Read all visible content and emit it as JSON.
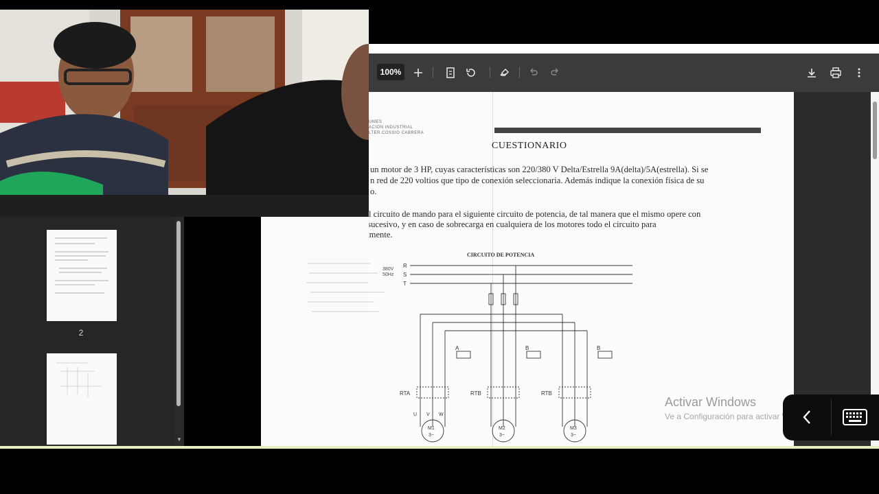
{
  "viewer": {
    "zoom_label": "100%",
    "toolbar_icons": [
      "zoom-in-icon",
      "fit-page-icon",
      "rotate-icon",
      "annotate-icon",
      "undo-icon",
      "redo-icon",
      "download-icon",
      "print-icon",
      "more-options-icon"
    ]
  },
  "document": {
    "header_lines": [
      "UMES",
      "ACION INDUSTRIAL",
      "LTER COSSIO CABRERA"
    ],
    "title": "CUESTIONARIO",
    "q1_line1": "un motor de 3 HP, cuyas características son  220/380 V Delta/Estrella 9A(delta)/5A(estrella). Si se",
    "q1_line2": "n red de 220 voltios que tipo de conexión seleccionaria. Además indique la conexión física de su",
    "q1_line3": "o.",
    "q2_line1": "l circuito de mando para el siguiente circuito de potencia, de tal manera que el mismo opere con",
    "q2_line2": "arranque sucesivo, y en caso de sobrecarga en cualquiera de los motores todo el circuito para",
    "q2_line3": "inmediatamente.",
    "diagram": {
      "title": "CIRCUITO DE POTENCIA",
      "supply": [
        "380V",
        "50Hz"
      ],
      "phases": [
        "R",
        "S",
        "T"
      ],
      "contactors": [
        "A",
        "B",
        "B"
      ],
      "relays": [
        "RTA",
        "RTB",
        "RTB"
      ],
      "motors": [
        "M1",
        "M2",
        "M3"
      ],
      "motor_sub": "3~",
      "terminals": [
        "U",
        "V",
        "W"
      ]
    }
  },
  "thumbnails": {
    "page_label": "2"
  },
  "watermark": {
    "title": "Activar Windows",
    "subtitle": "Ve a Configuración para activar Windows."
  },
  "colors": {
    "toolbar": "#3b3b3b",
    "sidebar": "#262626",
    "page": "#fcfcfc"
  }
}
